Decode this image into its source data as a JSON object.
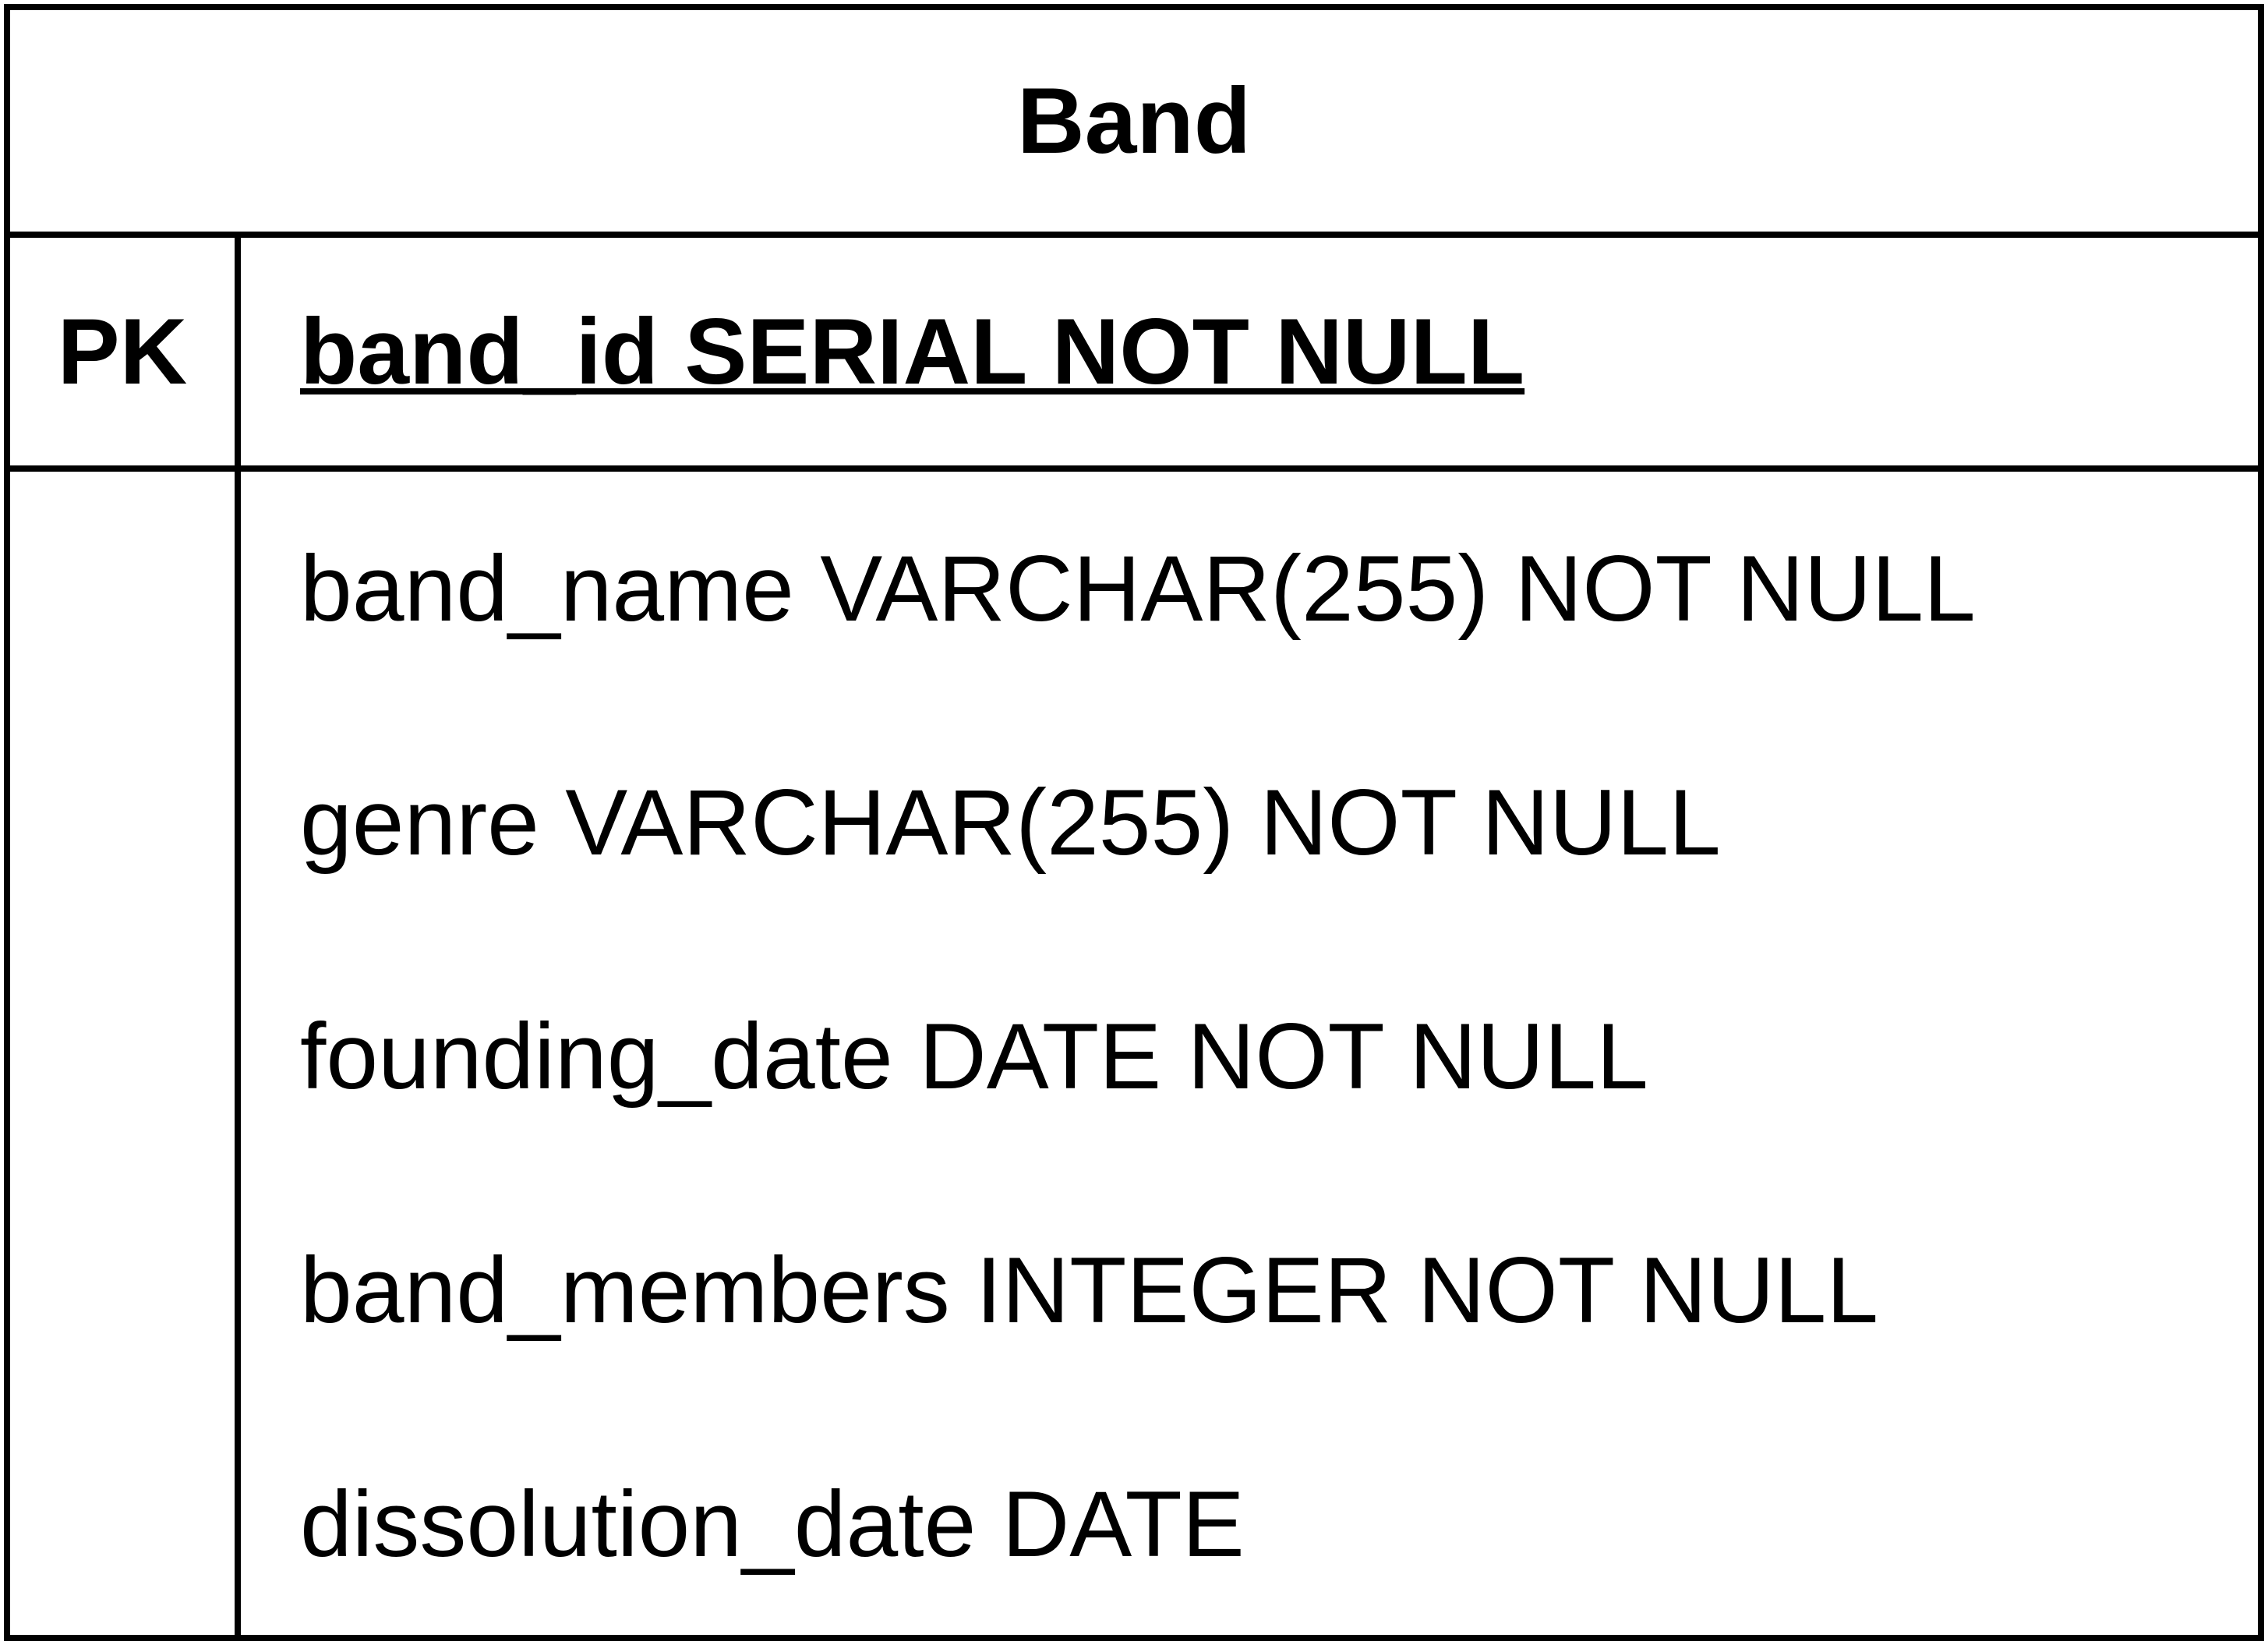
{
  "entity": {
    "title": "Band",
    "primary_key": {
      "label": "PK",
      "field": "band_id SERIAL NOT NULL"
    },
    "fields": [
      "band_name VARCHAR(255) NOT NULL",
      "genre VARCHAR(255) NOT NULL",
      "founding_date DATE NOT NULL",
      "band_members INTEGER NOT NULL",
      "dissolution_date DATE"
    ]
  }
}
